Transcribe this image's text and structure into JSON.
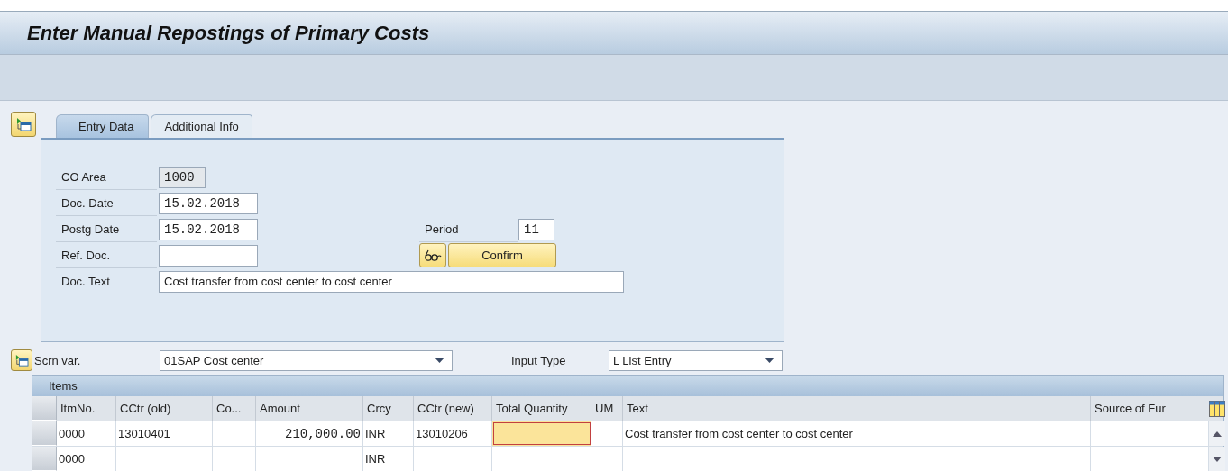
{
  "window": {
    "title": "Enter Manual Repostings of Primary Costs"
  },
  "tabs": [
    {
      "label": "Entry Data",
      "selected": true
    },
    {
      "label": "Additional Info",
      "selected": false
    }
  ],
  "header_fields": [
    {
      "label": "CO Area",
      "value": "1000",
      "kind": "readonly"
    },
    {
      "label": "Doc. Date",
      "value": "15.02.2018",
      "kind": "input"
    },
    {
      "label": "Postg Date",
      "value": "15.02.2018",
      "kind": "input"
    },
    {
      "label": "Ref. Doc.",
      "kind": "input"
    },
    {
      "label": "Doc. Text",
      "value": "Cost transfer from cost center to cost center",
      "kind": "wide"
    }
  ],
  "period": {
    "label": "Period",
    "value": "11"
  },
  "confirm_button": {
    "label": "Confirm"
  },
  "screen_variant": {
    "label": "Scrn var.",
    "value": "01SAP Cost center"
  },
  "input_type": {
    "label": "Input Type",
    "value": "L List Entry"
  },
  "table": {
    "title": "Items",
    "columns": [
      {
        "label": "ItmNo.",
        "kind": "text"
      },
      {
        "label": "CCtr (old)",
        "kind": "text"
      },
      {
        "label": "Co...",
        "kind": "text"
      },
      {
        "label": "Amount",
        "kind": "number"
      },
      {
        "label": "Crcy",
        "kind": "text"
      },
      {
        "label": "CCtr (new)",
        "kind": "text"
      },
      {
        "label": "Total Quantity",
        "kind": "text"
      },
      {
        "label": "UM",
        "kind": "text"
      },
      {
        "label": "Text",
        "kind": "text"
      },
      {
        "label": "Source of Fur",
        "kind": "text"
      }
    ],
    "rows": [
      {
        "cells": [
          {
            "text": "0000",
            "focused": false
          },
          {
            "text": "13010401",
            "focused": false
          },
          {
            "focused": false
          },
          {
            "text": "210,000.00",
            "focused": false
          },
          {
            "text": "INR",
            "focused": false
          },
          {
            "text": "13010206",
            "focused": false
          },
          {
            "focused": true
          },
          {
            "focused": false
          },
          {
            "text": "Cost transfer from cost center to cost center",
            "focused": false
          },
          {
            "focused": false
          }
        ]
      },
      {
        "cells": [
          {
            "text": "0000",
            "focused": false
          },
          {
            "focused": false
          },
          {
            "focused": false
          },
          {
            "focused": false
          },
          {
            "text": "INR",
            "focused": false
          },
          {
            "focused": false
          },
          {
            "focused": false
          },
          {
            "focused": false
          },
          {
            "focused": false
          },
          {
            "focused": false
          }
        ]
      }
    ]
  }
}
